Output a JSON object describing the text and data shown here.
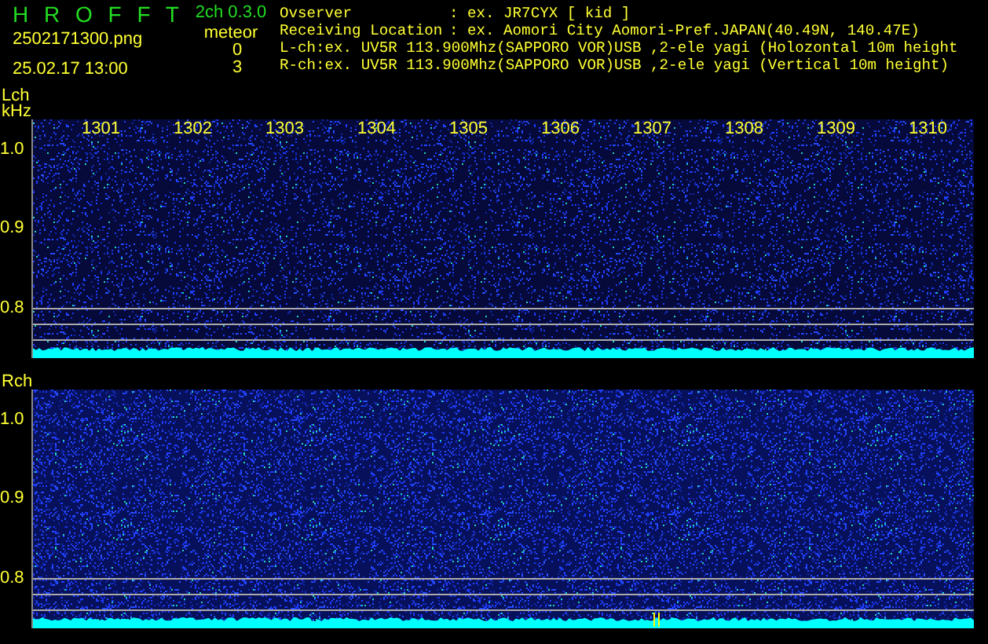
{
  "header": {
    "title": "H R O F F T",
    "version": "2ch 0.3.0",
    "filename": "2502171300.png",
    "timestamp": "25.02.17 13:00",
    "meteor_label": "meteor",
    "meteor_counts": [
      "0",
      "3"
    ]
  },
  "station": [
    {
      "label": "Ovserver",
      "value": ": ex. JR7CYX [ kid ]"
    },
    {
      "label": "Receiving Location",
      "value": ": ex. Aomori City Aomori-Pref.JAPAN(40.49N, 140.47E)"
    }
  ],
  "channel_lines": [
    "L-ch:ex. UV5R 113.900Mhz(SAPPORO VOR)USB ,2-ele yagi (Holozontal 10m height",
    "R-ch:ex. UV5R 113.900Mhz(SAPPORO VOR)USB ,2-ele yagi (Vertical 10m height)"
  ],
  "channels": [
    {
      "name": "Lch",
      "unit": "kHz",
      "y_labels": [
        "1.0",
        "0.9",
        "0.8"
      ],
      "x_labels": [
        "1301",
        "1302",
        "1303",
        "1304",
        "1305",
        "1306",
        "1307",
        "1308",
        "1309",
        "1310"
      ]
    },
    {
      "name": "Rch",
      "y_labels": [
        "1.0",
        "0.9",
        "0.8"
      ]
    }
  ]
}
